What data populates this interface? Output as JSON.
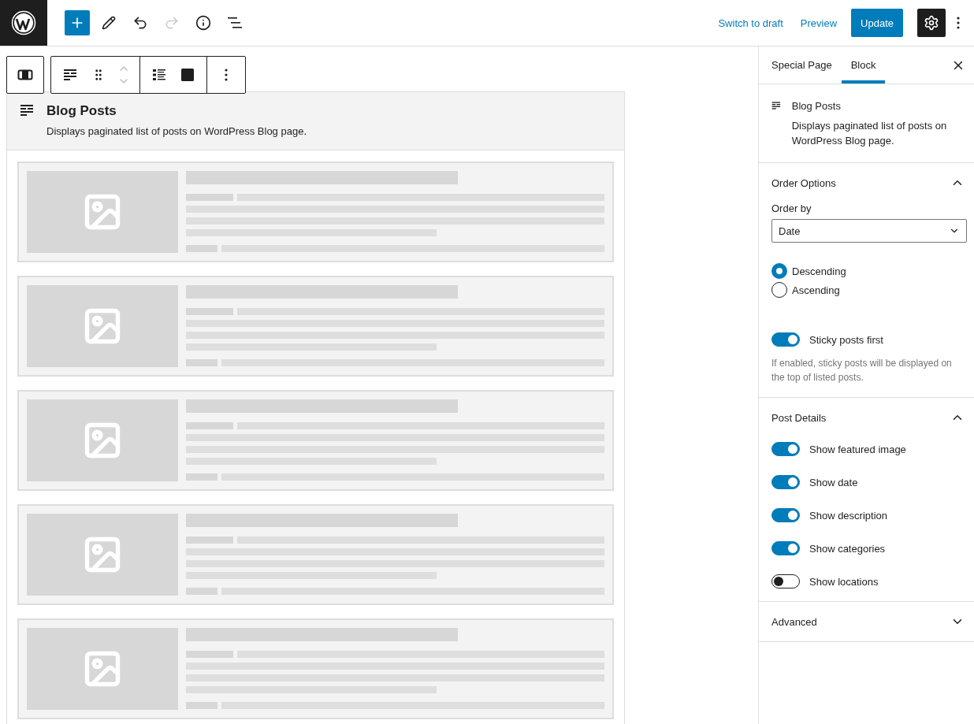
{
  "top_bar": {
    "redo_disabled": true,
    "links": [
      "Switch to draft",
      "Preview"
    ],
    "primary_button": "Update",
    "settings_active": true
  },
  "block": {
    "title": "Blog Posts",
    "description": "Displays paginated list of posts on WordPress Blog page.",
    "cards": [
      {
        "kind": "placeholder"
      },
      {
        "kind": "placeholder"
      },
      {
        "kind": "placeholder"
      },
      {
        "kind": "placeholder"
      },
      {
        "kind": "placeholder"
      }
    ]
  },
  "sidebar": {
    "tabs": [
      {
        "label": "Special Page",
        "selected": false
      },
      {
        "label": "Block",
        "selected": true
      }
    ],
    "block_card": {
      "title": "Blog Posts",
      "description": "Displays paginated list of posts on WordPress Blog page."
    },
    "panels": [
      {
        "title": "Order Options",
        "expanded": true,
        "controls": [
          {
            "kind": "select",
            "label": "Order by",
            "value": "Date"
          },
          {
            "kind": "radio_group",
            "options": [
              {
                "label": "Descending",
                "selected": true
              },
              {
                "label": "Ascending",
                "selected": false
              }
            ]
          },
          {
            "kind": "toggle",
            "label": "Sticky posts first",
            "on": true,
            "help": "If enabled, sticky posts will be displayed on the top of listed posts."
          }
        ]
      },
      {
        "title": "Post Details",
        "expanded": true,
        "controls": [
          {
            "kind": "toggle",
            "label": "Show featured image",
            "on": true
          },
          {
            "kind": "toggle",
            "label": "Show date",
            "on": true
          },
          {
            "kind": "toggle",
            "label": "Show description",
            "on": true
          },
          {
            "kind": "toggle",
            "label": "Show categories",
            "on": true
          },
          {
            "kind": "toggle",
            "label": "Show locations",
            "on": false
          }
        ]
      },
      {
        "title": "Advanced",
        "expanded": false
      }
    ]
  }
}
